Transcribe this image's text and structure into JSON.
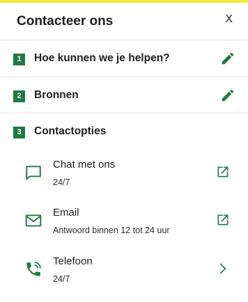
{
  "header": {
    "title": "Contacteer ons",
    "close_label": "X"
  },
  "steps": [
    {
      "number": "1",
      "label": "Hoe kunnen we je helpen?",
      "icon": "pencil-icon"
    },
    {
      "number": "2",
      "label": "Bronnen",
      "icon": "pencil-icon"
    },
    {
      "number": "3",
      "label": "Contactopties"
    }
  ],
  "options": [
    {
      "title": "Chat met ons",
      "subtitle": "24/7",
      "icon": "chat-bubble-icon",
      "action_icon": "external-link-icon"
    },
    {
      "title": "Email",
      "subtitle": "Antwoord binnen 12 tot 24 uur",
      "icon": "envelope-icon",
      "action_icon": "external-link-icon"
    },
    {
      "title": "Telefoon",
      "subtitle": "24/7",
      "icon": "phone-icon",
      "action_icon": "chevron-right-icon"
    }
  ],
  "colors": {
    "accent_green": "#1e7a43",
    "top_bar_yellow": "#f1e63c"
  }
}
